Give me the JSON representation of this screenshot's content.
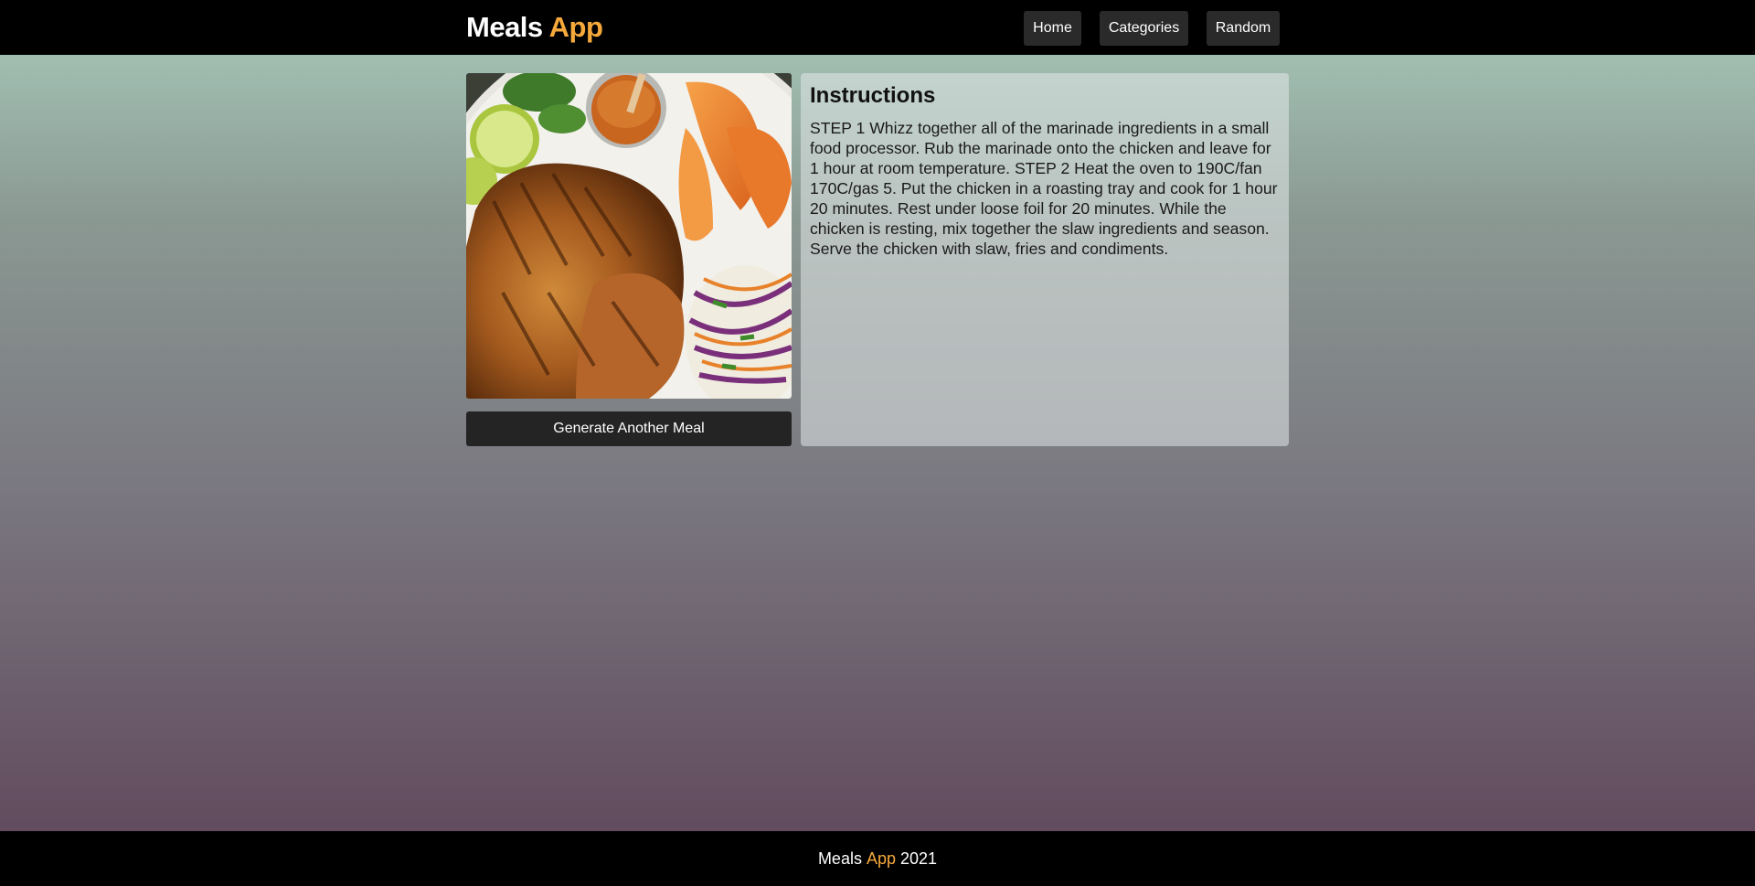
{
  "brand": {
    "name": "Meals",
    "accent": "App"
  },
  "nav": {
    "home": "Home",
    "categories": "Categories",
    "random": "Random"
  },
  "meal": {
    "image_alt": "grilled chicken with slaw and sweet potato fries",
    "generate_label": "Generate Another Meal"
  },
  "instructions": {
    "title": "Instructions",
    "text": "STEP 1 Whizz together all of the marinade ingredients in a small food processor. Rub the marinade onto the chicken and leave for 1 hour at room temperature. STEP 2 Heat the oven to 190C/fan 170C/gas 5. Put the chicken in a roasting tray and cook for 1 hour 20 minutes. Rest under loose foil for 20 minutes. While the chicken is resting, mix together the slaw ingredients and season. Serve the chicken with slaw, fries and condiments."
  },
  "footer": {
    "name": "Meals",
    "accent": "App",
    "year": "2021"
  },
  "colors": {
    "accent": "#f6a93b",
    "bar": "#000000",
    "button": "#2a2a2a"
  }
}
